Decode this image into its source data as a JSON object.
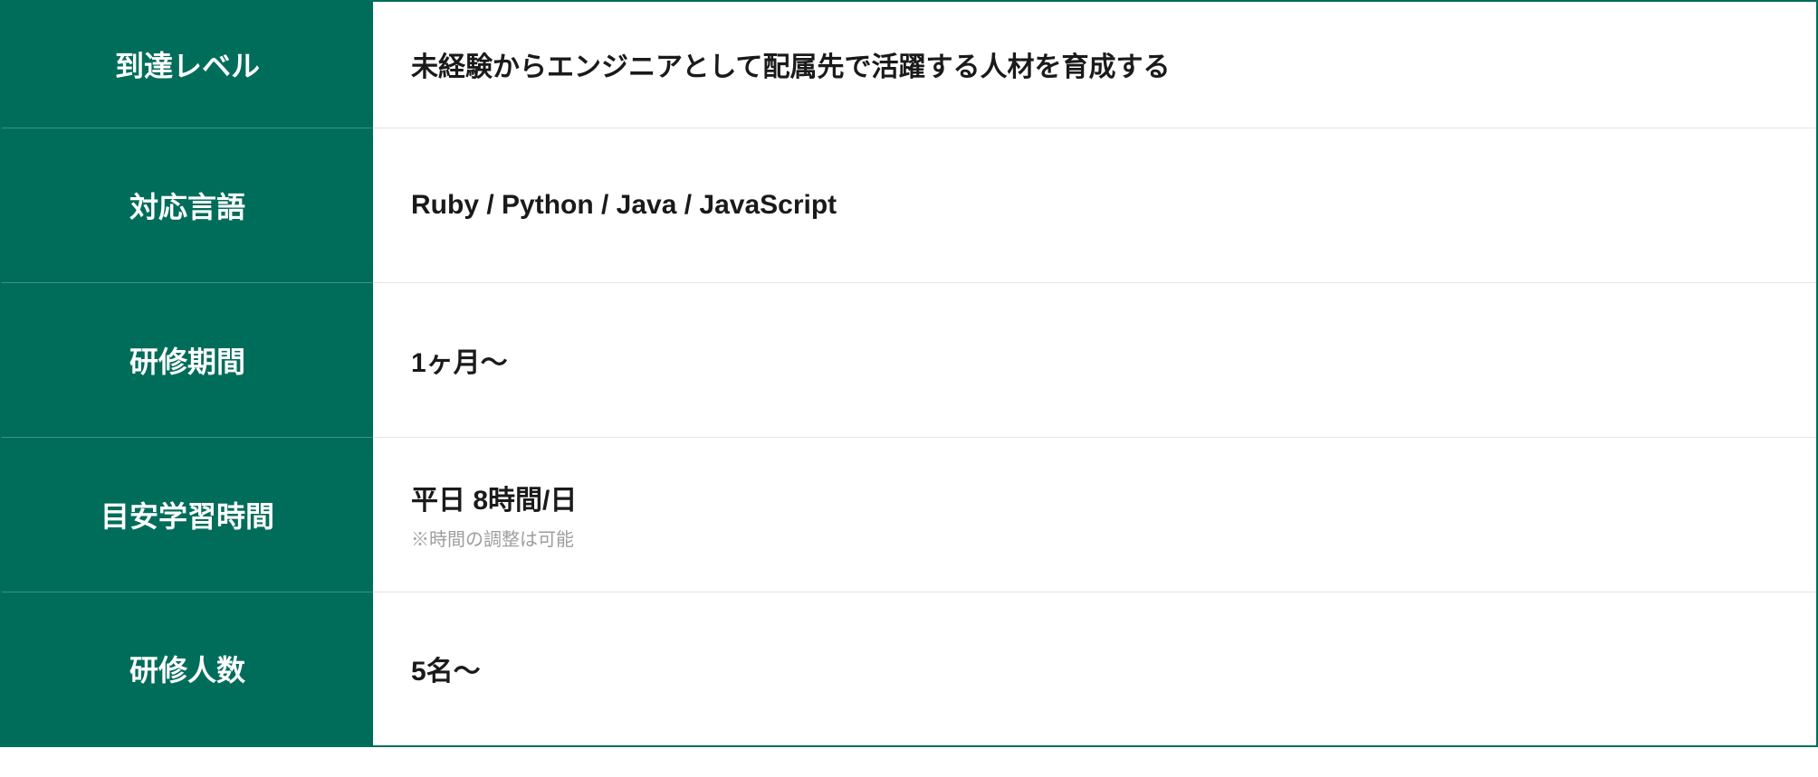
{
  "rows": [
    {
      "label": "到達レベル",
      "value": "未経験からエンジニアとして配属先で活躍する人材を育成する",
      "note": null
    },
    {
      "label": "対応言語",
      "value": "Ruby / Python / Java / JavaScript",
      "note": null
    },
    {
      "label": "研修期間",
      "value": "1ヶ月〜",
      "note": null
    },
    {
      "label": "目安学習時間",
      "value": "平日 8時間/日",
      "note": "※時間の調整は可能"
    },
    {
      "label": "研修人数",
      "value": "5名〜",
      "note": null
    }
  ]
}
